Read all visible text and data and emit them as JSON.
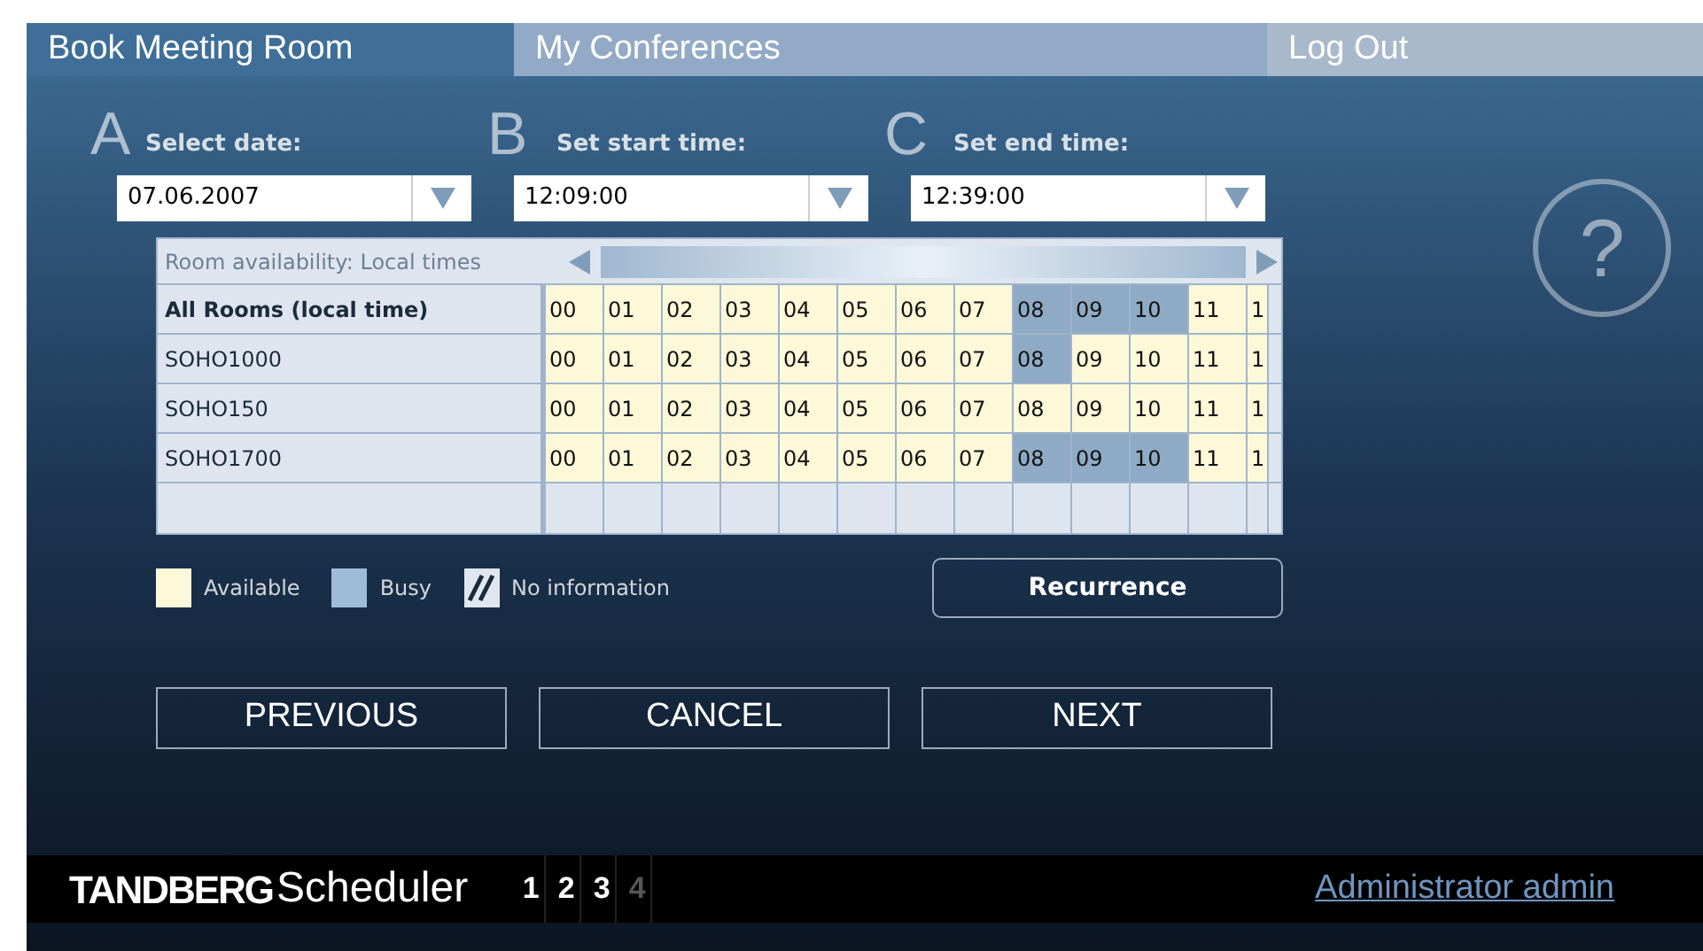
{
  "tabs": [
    {
      "label": "Book Meeting Room",
      "selected": true
    },
    {
      "label": "My Conferences",
      "selected": false
    },
    {
      "label": "Log Out",
      "selected": false
    }
  ],
  "fields": [
    {
      "letter": "A",
      "label": "Select date:",
      "value": "07.06.2007"
    },
    {
      "letter": "B",
      "label": "Set start time:",
      "value": "12:09:00"
    },
    {
      "letter": "C",
      "label": "Set end time:",
      "value": "12:39:00"
    }
  ],
  "help": {
    "label": "?"
  },
  "availability": {
    "title": "Room availability: Local times",
    "rows": [
      {
        "name": "All Rooms (local time)",
        "bold": true,
        "cells": [
          {
            "label": "00",
            "busy": false
          },
          {
            "label": "01",
            "busy": false
          },
          {
            "label": "02",
            "busy": false
          },
          {
            "label": "03",
            "busy": false
          },
          {
            "label": "04",
            "busy": false
          },
          {
            "label": "05",
            "busy": false
          },
          {
            "label": "06",
            "busy": false
          },
          {
            "label": "07",
            "busy": false
          },
          {
            "label": "08",
            "busy": true
          },
          {
            "label": "09",
            "busy": true
          },
          {
            "label": "10",
            "busy": true
          },
          {
            "label": "11",
            "busy": false
          },
          {
            "label": "1",
            "busy": false
          }
        ]
      },
      {
        "name": "SOHO1000",
        "bold": false,
        "cells": [
          {
            "label": "00",
            "busy": false
          },
          {
            "label": "01",
            "busy": false
          },
          {
            "label": "02",
            "busy": false
          },
          {
            "label": "03",
            "busy": false
          },
          {
            "label": "04",
            "busy": false
          },
          {
            "label": "05",
            "busy": false
          },
          {
            "label": "06",
            "busy": false
          },
          {
            "label": "07",
            "busy": false
          },
          {
            "label": "08",
            "busy": true
          },
          {
            "label": "09",
            "busy": false
          },
          {
            "label": "10",
            "busy": false
          },
          {
            "label": "11",
            "busy": false
          },
          {
            "label": "1",
            "busy": false
          }
        ]
      },
      {
        "name": "SOHO150",
        "bold": false,
        "cells": [
          {
            "label": "00",
            "busy": false
          },
          {
            "label": "01",
            "busy": false
          },
          {
            "label": "02",
            "busy": false
          },
          {
            "label": "03",
            "busy": false
          },
          {
            "label": "04",
            "busy": false
          },
          {
            "label": "05",
            "busy": false
          },
          {
            "label": "06",
            "busy": false
          },
          {
            "label": "07",
            "busy": false
          },
          {
            "label": "08",
            "busy": false
          },
          {
            "label": "09",
            "busy": false
          },
          {
            "label": "10",
            "busy": false
          },
          {
            "label": "11",
            "busy": false
          },
          {
            "label": "1",
            "busy": false
          }
        ]
      },
      {
        "name": "SOHO1700",
        "bold": false,
        "cells": [
          {
            "label": "00",
            "busy": false
          },
          {
            "label": "01",
            "busy": false
          },
          {
            "label": "02",
            "busy": false
          },
          {
            "label": "03",
            "busy": false
          },
          {
            "label": "04",
            "busy": false
          },
          {
            "label": "05",
            "busy": false
          },
          {
            "label": "06",
            "busy": false
          },
          {
            "label": "07",
            "busy": false
          },
          {
            "label": "08",
            "busy": true
          },
          {
            "label": "09",
            "busy": true
          },
          {
            "label": "10",
            "busy": true
          },
          {
            "label": "11",
            "busy": false
          },
          {
            "label": "1",
            "busy": false
          }
        ]
      }
    ]
  },
  "legend": [
    {
      "kind": "available",
      "label": "Available"
    },
    {
      "kind": "busy",
      "label": "Busy"
    },
    {
      "kind": "none",
      "label": "No information"
    }
  ],
  "recurrence_button": "Recurrence",
  "buttons": [
    "PREVIOUS",
    "CANCEL",
    "NEXT"
  ],
  "footer": {
    "brand_bold": "TANDBERG",
    "brand_rest": "Scheduler",
    "steps": [
      {
        "label": "1",
        "disabled": false
      },
      {
        "label": "2",
        "disabled": false
      },
      {
        "label": "3",
        "disabled": false
      },
      {
        "label": "4",
        "disabled": true
      }
    ],
    "user_link": "Administrator admin"
  }
}
